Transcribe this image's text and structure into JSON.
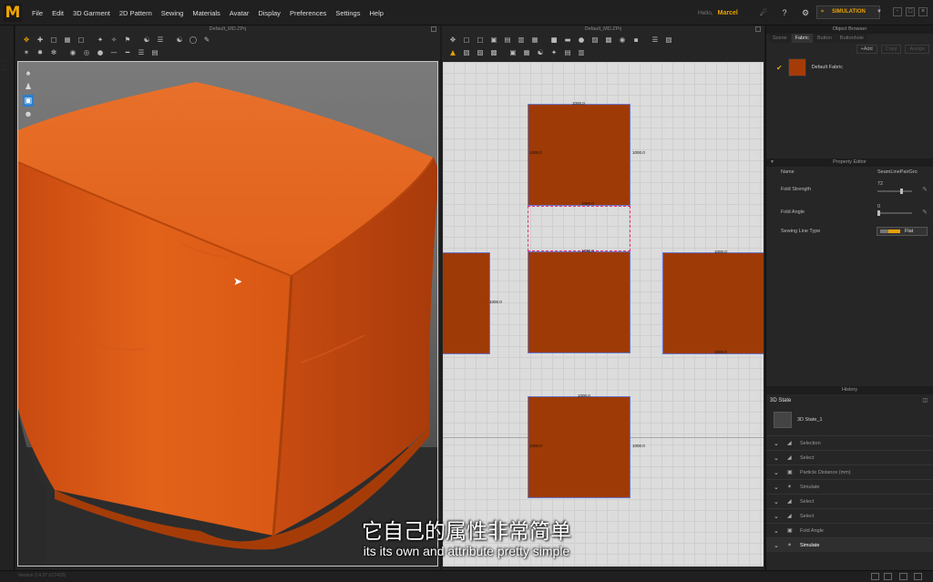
{
  "app": {
    "logo": "M",
    "menus": [
      "File",
      "Edit",
      "3D Garment",
      "2D Pattern",
      "Sewing",
      "Materials",
      "Avatar",
      "Display",
      "Preferences",
      "Settings",
      "Help"
    ],
    "user_greeting": "Hello,",
    "user_name": "Marcel",
    "simulation_label": "SIMULATION",
    "accent_color": "#e8a000"
  },
  "panel3d": {
    "title": "Default_MD.ZPrj",
    "fabric_color": "#e06018"
  },
  "panel2d": {
    "title": "Default_MD.ZPrj",
    "piece_color": "#9d3a06",
    "labels": {
      "top_w": "1000.0",
      "top_left": "1000.0",
      "top_right": "1000.0",
      "mid_top": "1000.0",
      "mid_bottom": "1000.0",
      "left_side": "1000.0",
      "right_top": "1000.0",
      "right_bottom": "1000.0",
      "bottom_top": "1000.0",
      "bottom_left": "1000.0",
      "bottom_right": "1000.0",
      "seam_bottom": "1000.0"
    }
  },
  "object_browser": {
    "title": "Object Browser",
    "tabs": [
      "Scene",
      "Fabric",
      "Button",
      "Buttonhole"
    ],
    "active_tab": "Fabric",
    "add_label": "+Add",
    "copy_label": "Copy",
    "assign_label": "Assign",
    "fabric_name": "Default Fabric",
    "fabric_color": "#a53c08"
  },
  "property_editor": {
    "title": "Property Editor",
    "rows": [
      {
        "label": "Name",
        "value": "SeamLinePairGro"
      },
      {
        "label": "Fold Strength",
        "value": "72"
      },
      {
        "label": "Fold Angle",
        "value": "0"
      },
      {
        "label": "Sewing Line Type",
        "value": "Flat"
      }
    ],
    "fold_strength_level": 0.72,
    "fold_angle_level": 0.0
  },
  "history": {
    "title": "History",
    "state_header": "3D State",
    "state_item": "3D State_1",
    "items": [
      "Selection",
      "Select",
      "Particle Distance (mm)",
      "Simulate",
      "Select",
      "Select",
      "Fold Angle",
      "Simulate"
    ]
  },
  "statusbar": {
    "text": "Version 2.4.37 (r17433)"
  },
  "subtitles": {
    "chinese": "它自己的属性非常简单",
    "english": "its its own and attribute pretty simple"
  }
}
